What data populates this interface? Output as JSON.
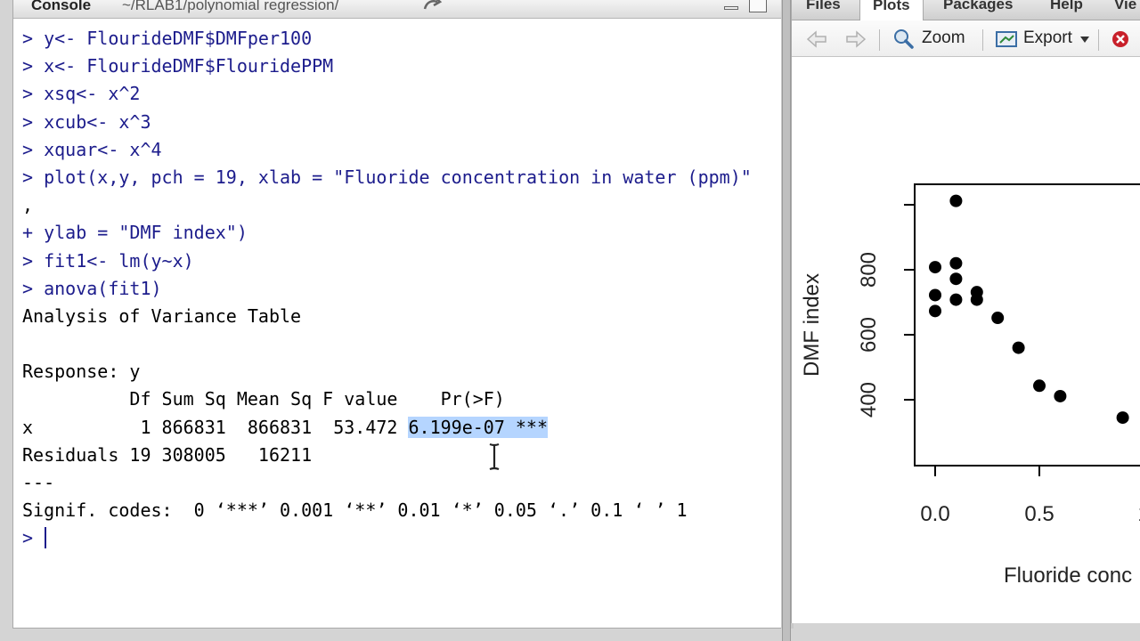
{
  "console": {
    "title": "Console",
    "path": "~/RLAB1/polynomial regression/",
    "lines": [
      {
        "prompt": "> ",
        "text": "y<- FlourideDMF$DMFper100"
      },
      {
        "prompt": "> ",
        "text": "x<- FlourideDMF$FlouridePPM"
      },
      {
        "prompt": "> ",
        "text": "xsq<- x^2"
      },
      {
        "prompt": "> ",
        "text": "xcub<- x^3"
      },
      {
        "prompt": "> ",
        "text": "xquar<- x^4"
      },
      {
        "prompt": "> ",
        "text": "plot(x,y, pch = 19, xlab = \"Fluoride concentration in water (ppm)\""
      },
      {
        "prompt": "",
        "text": ","
      },
      {
        "prompt": "+ ",
        "text": "ylab = \"DMF index\")"
      },
      {
        "prompt": "> ",
        "text": "fit1<- lm(y~x)"
      },
      {
        "prompt": "> ",
        "text": "anova(fit1)"
      },
      {
        "prompt": "",
        "text": "Analysis of Variance Table"
      },
      {
        "prompt": "",
        "text": ""
      },
      {
        "prompt": "",
        "text": "Response: y"
      },
      {
        "prompt": "",
        "text": "          Df Sum Sq Mean Sq F value    Pr(>F)"
      },
      {
        "prompt": "",
        "text": "x          1 866831  866831  53.472 "
      },
      {
        "prompt": "",
        "text": "Residuals 19 308005   16211"
      },
      {
        "prompt": "",
        "text": "---"
      },
      {
        "prompt": "",
        "text": "Signif. codes:  0 ‘***’ 0.001 ‘**’ 0.01 ‘*’ 0.05 ‘.’ 0.1 ‘ ’ 1"
      },
      {
        "prompt": "> ",
        "text": ""
      }
    ],
    "highlighted": "6.199e-07 ***"
  },
  "tabs": [
    "Files",
    "Plots",
    "Packages",
    "Help",
    "Vie"
  ],
  "toolbar": {
    "zoom": "Zoom",
    "export": "Export"
  },
  "chart_data": {
    "type": "scatter",
    "xlabel": "Fluoride conc",
    "ylabel": "DMF index",
    "x_ticks": [
      "0.0",
      "0.5",
      "1"
    ],
    "y_ticks": [
      "400",
      "600",
      "800"
    ],
    "xlim": [
      0,
      1.0
    ],
    "ylim": [
      225,
      1250
    ],
    "x": [
      0.1,
      0.0,
      0.1,
      0.1,
      0.0,
      0.2,
      0.2,
      0.0,
      0.1,
      0.3,
      0.4,
      0.5,
      0.6,
      0.9
    ],
    "y": [
      1012,
      808,
      820,
      772,
      722,
      731,
      708,
      673,
      708,
      652,
      560,
      443,
      411,
      345
    ]
  }
}
